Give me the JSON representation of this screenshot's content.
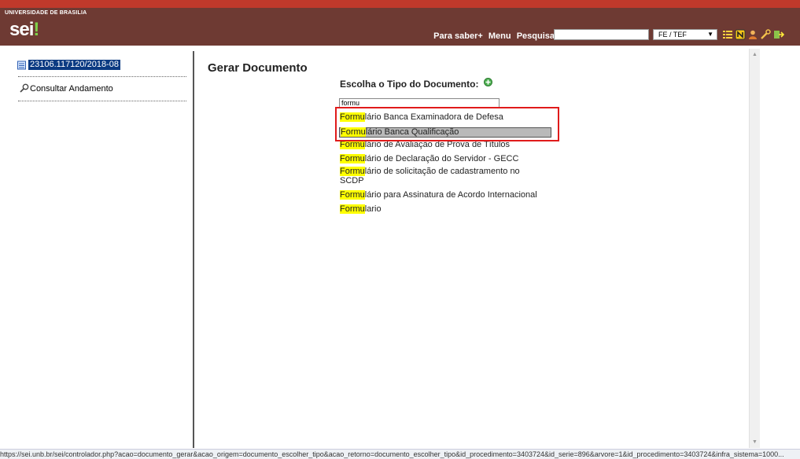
{
  "header": {
    "institution": "UNIVERSIDADE DE BRASILIA",
    "logo_text": "sei",
    "logo_dot": "!",
    "links": [
      "Para saber+",
      "Menu",
      "Pesquisa"
    ],
    "search_value": "",
    "unit_selected": "FE / TEF",
    "icons": [
      "list-icon",
      "notes-icon",
      "user-icon",
      "tools-icon",
      "exit-icon"
    ],
    "colors": {
      "top_bar": "#c0392b",
      "header_bg": "#6e3a33",
      "logo_dot": "#7fd14a"
    }
  },
  "sidebar": {
    "process_number": "23106.117120/2018-08",
    "consult_label": "Consultar Andamento"
  },
  "main": {
    "title": "Gerar Documento",
    "choose_label": "Escolha o Tipo do Documento:",
    "filter_value": "formu",
    "options": [
      {
        "match": "Formu",
        "rest": "lário Banca Examinadora de Defesa"
      },
      {
        "match": "Formu",
        "rest": "lário Banca Qualificação"
      },
      {
        "match": "Formu",
        "rest": "lário de Avaliação de Prova de Títulos"
      },
      {
        "match": "Formu",
        "rest": "lário de Declaração do Servidor - GECC"
      },
      {
        "match": "Formu",
        "rest": "lário de solicitação de cadastramento no"
      },
      {
        "match": "",
        "rest": "SCDP"
      },
      {
        "match": "Formu",
        "rest": "lário para Assinatura de Acordo Internacional"
      },
      {
        "match": "Formu",
        "rest": "lario"
      }
    ],
    "highlight_color": "#e01b1b"
  },
  "status_url": "https://sei.unb.br/sei/controlador.php?acao=documento_gerar&acao_origem=documento_escolher_tipo&acao_retorno=documento_escolher_tipo&id_procedimento=3403724&id_serie=896&arvore=1&id_procedimento=3403724&infra_sistema=1000..."
}
